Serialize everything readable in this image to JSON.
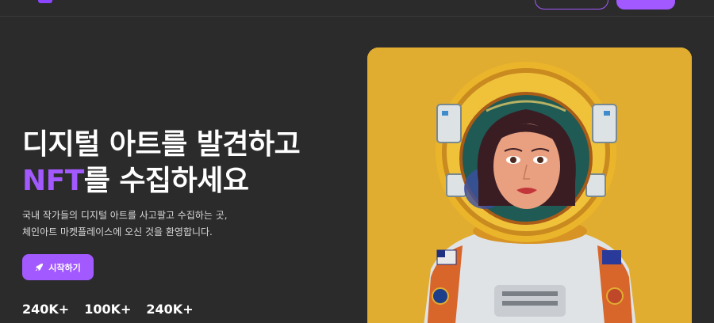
{
  "hero": {
    "title_line1": "디지털 아트를 발견하고",
    "title_accent": "NFT",
    "title_line2_rest": "를 수집하세요",
    "desc_line1": "국내 작가들의 디지털 아트를 사고팔고 수집하는 곳,",
    "desc_line2": "체인아트 마켓플레이스에 오신 것을 환영합니다.",
    "cta_label": "시작하기",
    "cta_icon": "rocket-icon"
  },
  "stats": [
    "240K+",
    "100K+",
    "240K+"
  ],
  "colors": {
    "background": "#2b2b2b",
    "accent": "#a259ff",
    "card_background": "#e1ad30"
  }
}
